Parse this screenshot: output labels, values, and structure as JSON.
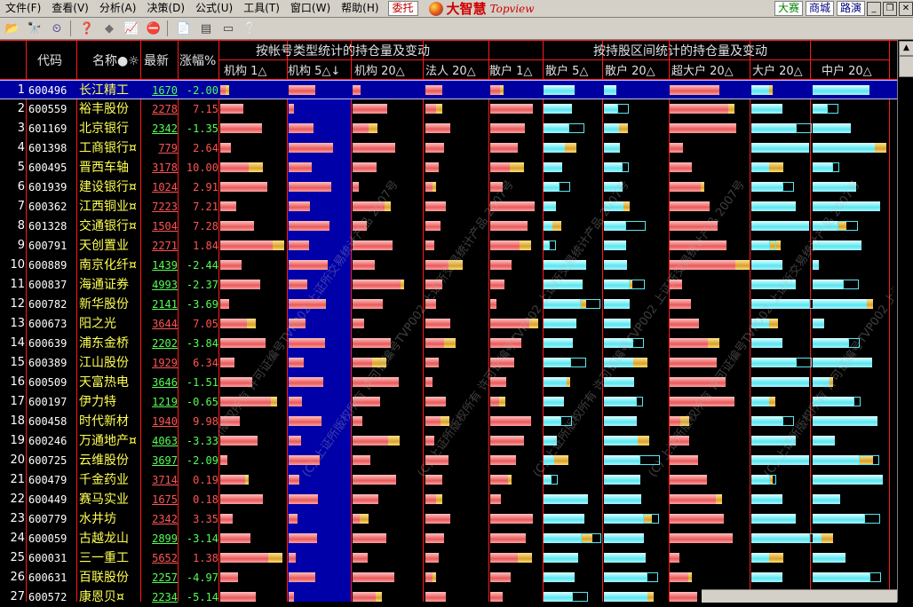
{
  "menu": {
    "items": [
      "文件(F)",
      "查看(V)",
      "分析(A)",
      "决策(D)",
      "公式(U)",
      "工具(T)",
      "窗口(W)",
      "帮助(H)"
    ],
    "weituo": "委托",
    "brand_cn": "大智慧",
    "brand_en": "Topview",
    "right_buttons": [
      "大赛",
      "商城",
      "路演"
    ]
  },
  "toolbar": {
    "icons": [
      "folder-icon",
      "binoculars-icon",
      "clock-icon",
      "help-book-icon",
      "diamond-icon",
      "chart-icon",
      "stop-icon",
      "doc-icon",
      "window-icon",
      "text-icon",
      "whatsthis-icon"
    ]
  },
  "columns": {
    "code": "代码",
    "name": "名称●☼",
    "price": "最新",
    "change": "涨幅%",
    "group1": "按帐号类型统计的持仓量及变动",
    "group2": "按持股区间统计的持仓量及变动",
    "sub": [
      "机构 1△",
      "机构 5△↓",
      "机构 20△",
      "法人 20△",
      "散户 1△",
      "散户 5△",
      "散户 20△",
      "超大户 20△",
      "大户 20△",
      "中户 20△"
    ]
  },
  "watermark": "(C) 上证所版权所有 许可证编号TVP002 上证所交易统计产品 2007号",
  "rows": [
    {
      "n": "1",
      "code": "600496",
      "name": "长江精工",
      "price": "1670",
      "chg": "-2.00",
      "dir": "dn"
    },
    {
      "n": "2",
      "code": "600559",
      "name": "裕丰股份",
      "price": "2278",
      "chg": "7.15",
      "dir": "up"
    },
    {
      "n": "3",
      "code": "601169",
      "name": "北京银行",
      "price": "2342",
      "chg": "-1.35",
      "dir": "dn"
    },
    {
      "n": "4",
      "code": "601398",
      "name": "工商银行¤",
      "price": "779",
      "chg": "2.64",
      "dir": "up"
    },
    {
      "n": "5",
      "code": "600495",
      "name": "晋西车轴",
      "price": "3178",
      "chg": "10.00",
      "dir": "up"
    },
    {
      "n": "6",
      "code": "601939",
      "name": "建设银行¤",
      "price": "1024",
      "chg": "2.91",
      "dir": "up"
    },
    {
      "n": "7",
      "code": "600362",
      "name": "江西铜业¤",
      "price": "7223",
      "chg": "7.21",
      "dir": "up"
    },
    {
      "n": "8",
      "code": "601328",
      "name": "交通银行¤",
      "price": "1504",
      "chg": "7.28",
      "dir": "up"
    },
    {
      "n": "9",
      "code": "600791",
      "name": "天创置业",
      "price": "2271",
      "chg": "1.84",
      "dir": "up"
    },
    {
      "n": "10",
      "code": "600889",
      "name": "南京化纤¤",
      "price": "1439",
      "chg": "-2.44",
      "dir": "dn"
    },
    {
      "n": "11",
      "code": "600837",
      "name": "海通证券",
      "price": "4993",
      "chg": "-2.37",
      "dir": "dn"
    },
    {
      "n": "12",
      "code": "600782",
      "name": "新华股份",
      "price": "2141",
      "chg": "-3.69",
      "dir": "dn"
    },
    {
      "n": "13",
      "code": "600673",
      "name": "阳之光",
      "price": "3644",
      "chg": "7.05",
      "dir": "up"
    },
    {
      "n": "14",
      "code": "600639",
      "name": "浦东金桥",
      "price": "2202",
      "chg": "-3.84",
      "dir": "dn"
    },
    {
      "n": "15",
      "code": "600389",
      "name": "江山股份",
      "price": "1929",
      "chg": "6.34",
      "dir": "up"
    },
    {
      "n": "16",
      "code": "600509",
      "name": "天富热电",
      "price": "3646",
      "chg": "-1.51",
      "dir": "dn"
    },
    {
      "n": "17",
      "code": "600197",
      "name": "伊力特",
      "price": "1219",
      "chg": "-0.65",
      "dir": "dn"
    },
    {
      "n": "18",
      "code": "600458",
      "name": "时代新材",
      "price": "1940",
      "chg": "9.98",
      "dir": "up"
    },
    {
      "n": "19",
      "code": "600246",
      "name": "万通地产¤",
      "price": "4063",
      "chg": "-3.33",
      "dir": "dn"
    },
    {
      "n": "20",
      "code": "600725",
      "name": "云维股份",
      "price": "3697",
      "chg": "-2.09",
      "dir": "dn"
    },
    {
      "n": "21",
      "code": "600479",
      "name": "千金药业",
      "price": "3714",
      "chg": "0.19",
      "dir": "up"
    },
    {
      "n": "22",
      "code": "600449",
      "name": "赛马实业",
      "price": "1675",
      "chg": "0.18",
      "dir": "up"
    },
    {
      "n": "23",
      "code": "600779",
      "name": "水井坊",
      "price": "2342",
      "chg": "3.35",
      "dir": "up"
    },
    {
      "n": "24",
      "code": "600059",
      "name": "古越龙山",
      "price": "2899",
      "chg": "-3.14",
      "dir": "dn"
    },
    {
      "n": "25",
      "code": "600031",
      "name": "三一重工",
      "price": "5652",
      "chg": "1.38",
      "dir": "up"
    },
    {
      "n": "26",
      "code": "600631",
      "name": "百联股份",
      "price": "2257",
      "chg": "-4.97",
      "dir": "dn"
    },
    {
      "n": "27",
      "code": "600572",
      "name": "康恩贝¤",
      "price": "2234",
      "chg": "-5.14",
      "dir": "dn"
    }
  ],
  "colors": {
    "up": "#ff5454",
    "down": "#54ff54",
    "grid": "#ff1a1a",
    "name": "#ffff54",
    "selected": "#0000a0"
  }
}
